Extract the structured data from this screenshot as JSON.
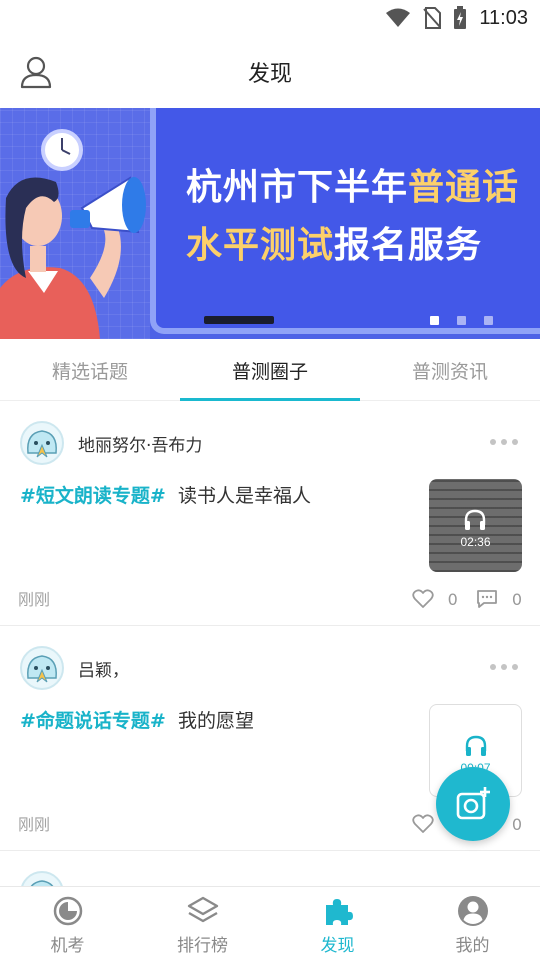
{
  "status_bar": {
    "time": "11:03"
  },
  "header": {
    "title": "发现",
    "profile_icon": "person-outline-icon"
  },
  "banner": {
    "line1_white": "杭州市下半年",
    "line1_yellow": "普通话",
    "line2_yellow": "水平测试",
    "line2_white": "报名服务",
    "active_dot": 0,
    "dot_count": 3
  },
  "tabs": [
    {
      "label": "精选话题",
      "active": false
    },
    {
      "label": "普测圈子",
      "active": true
    },
    {
      "label": "普测资讯",
      "active": false
    }
  ],
  "posts": [
    {
      "username": "地丽努尔·吾布力",
      "topic": "#短文朗读专题#",
      "text": "读书人是幸福人",
      "time": "刚刚",
      "likes": "0",
      "comments": "0",
      "duration": "02:36"
    },
    {
      "username": "吕颖，",
      "topic": "#命题说话专题#",
      "text": "我的愿望",
      "time": "刚刚",
      "likes": "0",
      "comments": "0",
      "duration": "00:07"
    }
  ],
  "fab": {
    "icon": "add-photo-icon"
  },
  "bottom_nav": [
    {
      "label": "机考",
      "icon": "exam-clock-icon",
      "active": false
    },
    {
      "label": "排行榜",
      "icon": "layers-icon",
      "active": false
    },
    {
      "label": "发现",
      "icon": "puzzle-icon",
      "active": true
    },
    {
      "label": "我的",
      "icon": "user-circle-icon",
      "active": false
    }
  ],
  "colors": {
    "accent": "#1fb8cf",
    "banner_bg": "#4d62e6",
    "banner_yellow": "#fcd06a"
  }
}
